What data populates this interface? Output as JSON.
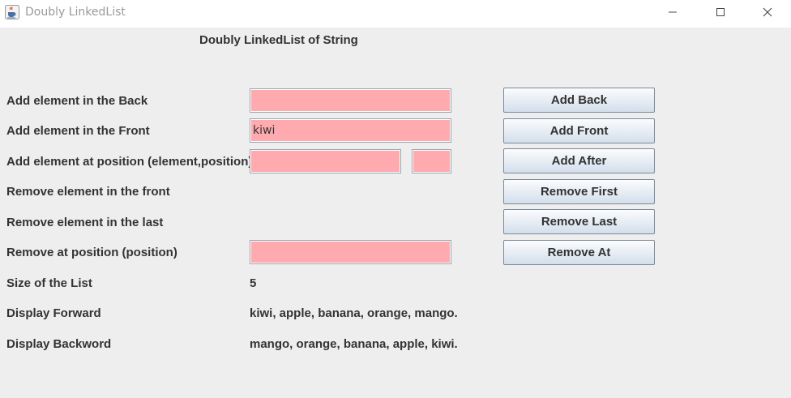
{
  "window": {
    "title": "Doubly LinkedList",
    "app_icon": "java-cup-icon",
    "controls": [
      "minimize-icon",
      "maximize-icon",
      "close-icon"
    ]
  },
  "heading": "Doubly LinkedList of String",
  "rows": {
    "add_back": {
      "label": "Add element in the Back",
      "input_value": "",
      "button": "Add Back"
    },
    "add_front": {
      "label": "Add element in the Front",
      "input_value": "kiwi",
      "button": "Add Front"
    },
    "add_after": {
      "label": "Add element at position (element,position)",
      "element_value": "",
      "position_value": "",
      "button": "Add After"
    },
    "remove_first": {
      "label": "Remove element in the front",
      "button": "Remove First"
    },
    "remove_last": {
      "label": "Remove element in the last",
      "button": "Remove Last"
    },
    "remove_at": {
      "label": "Remove at position (position)",
      "input_value": "",
      "button": "Remove At"
    }
  },
  "info": {
    "size": {
      "label": "Size of the List",
      "value": "5"
    },
    "forward": {
      "label": "Display Forward",
      "value": "kiwi, apple, banana, orange, mango."
    },
    "backward": {
      "label": "Display Backword",
      "value": "mango, orange, banana, apple, kiwi."
    }
  },
  "colors": {
    "input_bg": "#ffaaaf",
    "panel_bg": "#eeeeee",
    "text": "#333333"
  }
}
